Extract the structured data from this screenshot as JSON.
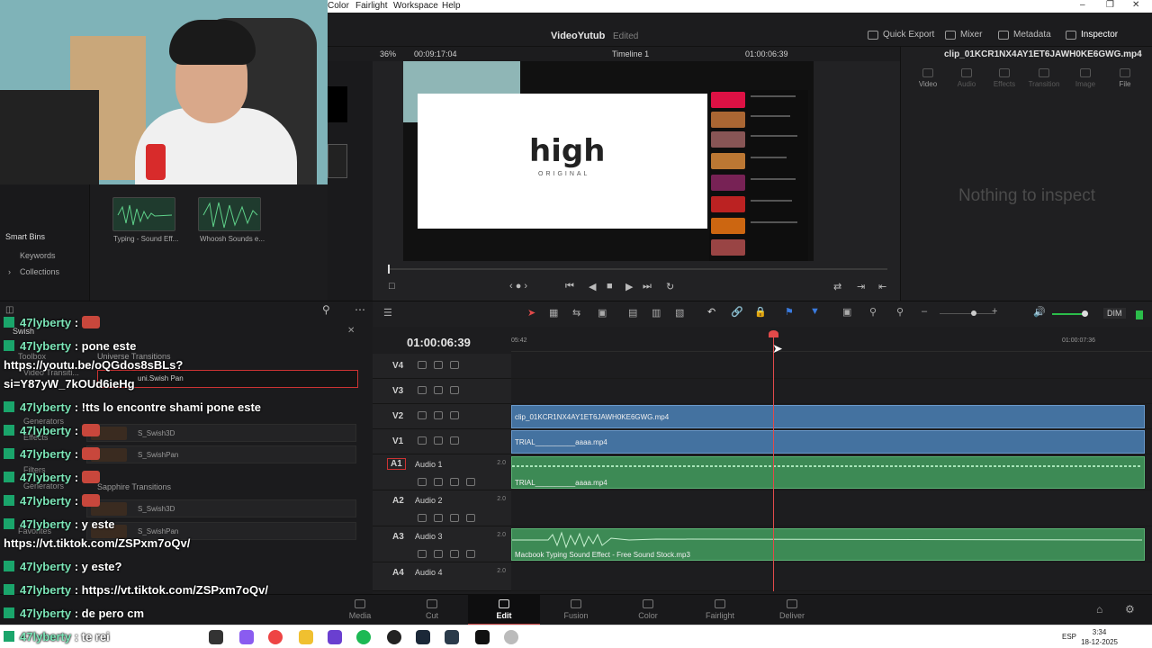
{
  "menubar": {
    "items": [
      "Color",
      "Fairlight",
      "Workspace",
      "Help"
    ]
  },
  "header": {
    "project_title": "VideoYutub",
    "project_status": "Edited",
    "buttons": [
      "Quick Export",
      "Mixer",
      "Metadata",
      "Inspector"
    ]
  },
  "viewer": {
    "zoom": "36%",
    "duration": "00:09:17:04",
    "timeline_name": "Timeline 1",
    "timecode": "01:00:06:39",
    "frame_text": "high",
    "frame_subtext": "ORIGINAL"
  },
  "media": {
    "clips": [
      {
        "label": "Typing - Sound Eff..."
      },
      {
        "label": "Whoosh Sounds e..."
      }
    ],
    "partial_labels": [
      "Macbook Typing S...",
      "Timeline 1",
      "nd.p..."
    ]
  },
  "bins": {
    "smart_bins": "Smart Bins",
    "keywords": "Keywords",
    "collections": "Collections"
  },
  "inspector": {
    "file": "clip_01KCR1NX4AY1ET6JAWH0KE6GWG.mp4",
    "tabs": [
      "Video",
      "Audio",
      "Effects",
      "Transition",
      "Image",
      "File"
    ],
    "empty_message": "Nothing to inspect"
  },
  "effects": {
    "search_value": "Swish",
    "toolbox": "Toolbox",
    "video_transitions": "Video Transiti...",
    "universe_transitions": "Universe Transitions",
    "search_result": "uni.Swish Pan",
    "generators": "Generators",
    "effects": "Effects",
    "sapphire": "Sapphire Transitions",
    "filters": "Filters",
    "generators2": "Generators",
    "favorites": "Favorites",
    "rows_a": [
      "S_Swish3D",
      "S_SwishPan"
    ],
    "rows_b": [
      "S_Swish3D",
      "S_SwishPan"
    ]
  },
  "timeline": {
    "timecode": "01:00:06:39",
    "ruler_left": "05:42",
    "ruler_right": "01:00:07:36",
    "tracks": [
      {
        "id": "V4",
        "name": ""
      },
      {
        "id": "V3",
        "name": ""
      },
      {
        "id": "V2",
        "name": ""
      },
      {
        "id": "V1",
        "name": ""
      },
      {
        "id": "A1",
        "name": "Audio 1",
        "num": "2.0"
      },
      {
        "id": "A2",
        "name": "Audio 2",
        "num": "2.0"
      },
      {
        "id": "A3",
        "name": "Audio 3",
        "num": "2.0"
      },
      {
        "id": "A4",
        "name": "Audio 4",
        "num": "2.0"
      }
    ],
    "clips": {
      "v2": "clip_01KCR1NX4AY1ET6JAWH0KE6GWG.mp4",
      "v1": "TRIAL__________aaaa.mp4",
      "a1": "TRIAL__________aaaa.mp4",
      "a3": "Macbook Typing Sound Effect - Free Sound Stock.mp3"
    },
    "dim": "DIM"
  },
  "pagenav": {
    "items": [
      "Media",
      "Cut",
      "Edit",
      "Fusion",
      "Color",
      "Fairlight",
      "Deliver"
    ],
    "active": "Edit"
  },
  "taskbar": {
    "lang": "ESP",
    "time": "3:34",
    "date": "18-12-2025"
  },
  "chat": [
    {
      "user": "47lyberty",
      "text": ":"
    },
    {
      "user": "47lyberty",
      "text": ": pone este"
    },
    {
      "cont": "https://youtu.be/oQGdos8sBLs?"
    },
    {
      "cont": "si=Y87yW_7kOUd6ieHg"
    },
    {
      "user": "47lyberty",
      "text": ": !tts lo encontre shami pone este"
    },
    {
      "user": "47lyberty",
      "text": ":"
    },
    {
      "user": "47lyberty",
      "text": ":"
    },
    {
      "user": "47lyberty",
      "text": ":"
    },
    {
      "user": "47lyberty",
      "text": ":"
    },
    {
      "user": "47lyberty",
      "text": ": y este"
    },
    {
      "cont": "https://vt.tiktok.com/ZSPxm7oQv/"
    },
    {
      "user": "47lyberty",
      "text": ": y este?"
    },
    {
      "user": "47lyberty",
      "text": ": https://vt.tiktok.com/ZSPxm7oQv/"
    },
    {
      "user": "47lyberty",
      "text": ": de pero cm"
    },
    {
      "user": "47lyberty",
      "text": ": te rei"
    }
  ],
  "colors": {
    "accent_red": "#e24a4a",
    "video_clip": "#4472a0",
    "audio_clip": "#3d8a55",
    "chat_user": "#7ce6b8"
  }
}
